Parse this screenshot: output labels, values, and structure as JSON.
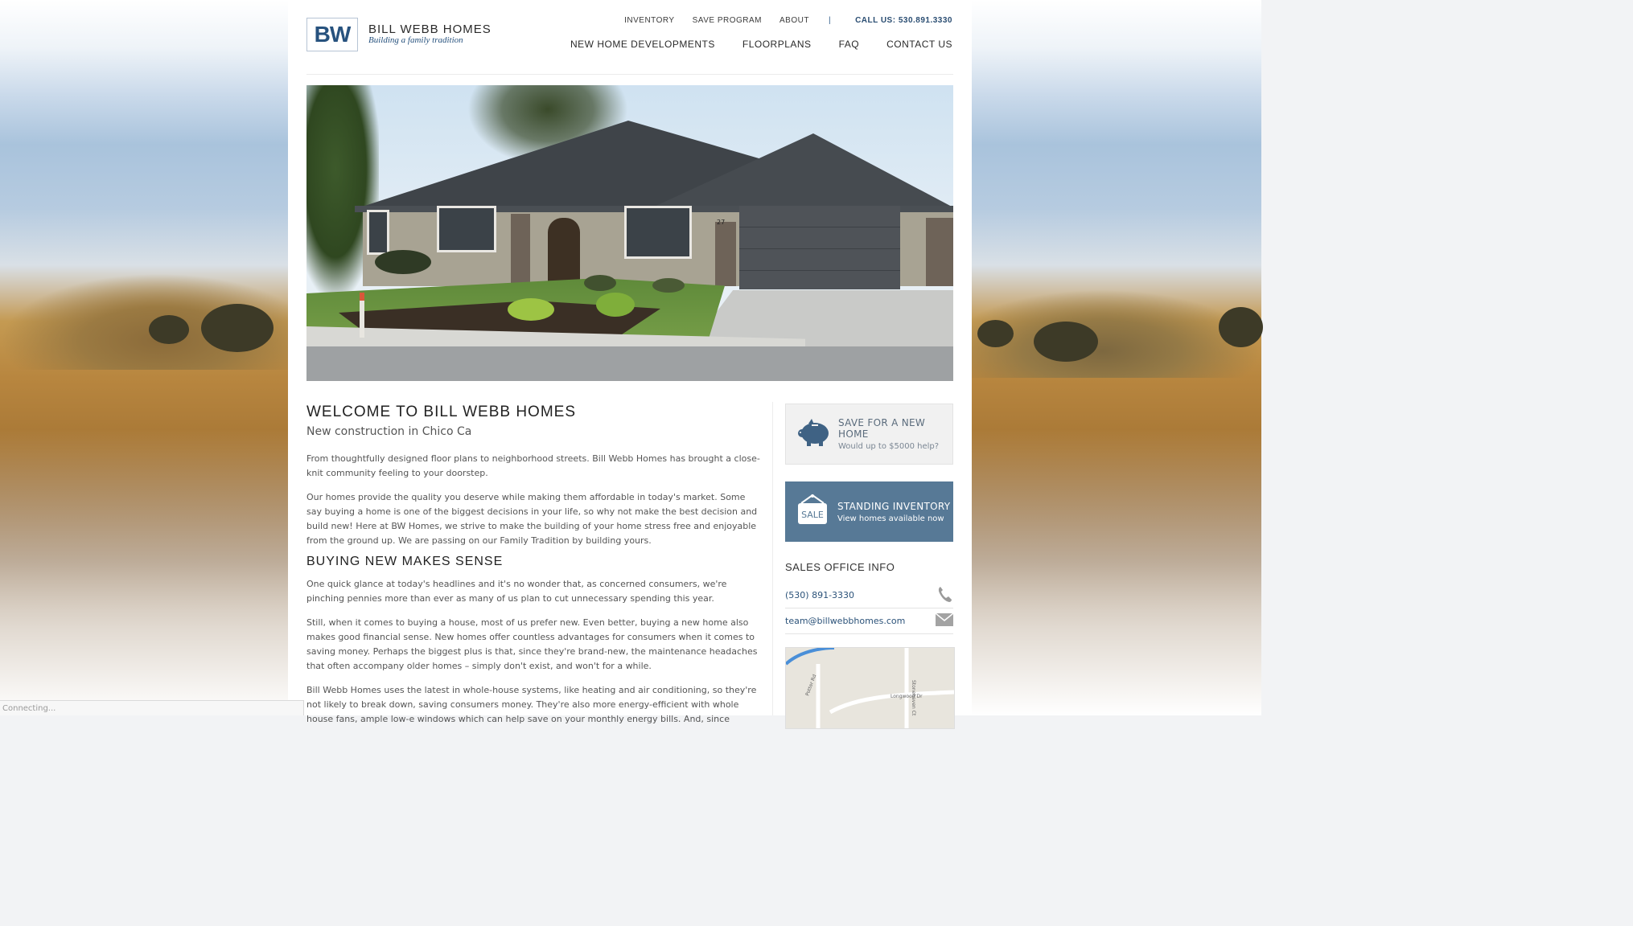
{
  "brand": {
    "monogram": "BW",
    "name": "BILL WEBB HOMES",
    "tagline": "Building a family tradition",
    "accent": "#27527e"
  },
  "top_nav": {
    "items": [
      "INVENTORY",
      "SAVE PROGRAM",
      "ABOUT"
    ],
    "separator": "|",
    "call": "CALL US: 530.891.3330"
  },
  "main_nav": {
    "items": [
      "NEW HOME DEVELOPMENTS",
      "FLOORPLANS",
      "FAQ",
      "CONTACT US"
    ]
  },
  "hero": {
    "house_number": "27"
  },
  "welcome": {
    "title": "WELCOME TO BILL WEBB HOMES",
    "subtitle": "New construction in Chico Ca",
    "paragraphs": [
      "From thoughtfully designed floor plans to neighborhood streets. Bill Webb Homes has brought a close-knit community feeling to your doorstep.",
      "Our homes provide the quality you deserve while making them affordable in today's market. Some say buying a home is one of the biggest decisions in your life, so why not make the best decision and build new! Here at BW Homes, we strive to make the building of your home stress free and enjoyable from the ground up. We are passing on our Family Tradition by building yours."
    ]
  },
  "buying": {
    "title": "BUYING NEW MAKES SENSE",
    "paragraphs": [
      "One quick glance at today's headlines and it's no wonder that, as concerned consumers, we're pinching pennies more than ever as many of us plan to cut unnecessary spending this year.",
      "Still, when it comes to buying a house, most of us prefer new. Even better, buying a new home also makes good financial sense. New homes offer countless advantages for consumers when it comes to saving money. Perhaps the biggest plus is that, since they're brand-new, the maintenance headaches that often accompany older homes – simply don't exist, and won't for a while.",
      "Bill Webb Homes uses the latest in whole-house systems, like heating and air conditioning, so they're not likely to break down, saving consumers money. They're also more energy-efficient with whole house fans, ample low-e windows which can help save on your monthly energy bills. And, since"
    ]
  },
  "sidebar": {
    "save_card": {
      "title": "SAVE FOR A NEW HOME",
      "subtitle": "Would up to $5000 help?",
      "icon": "piggy-bank-icon"
    },
    "inventory_card": {
      "title": "STANDING INVENTORY",
      "subtitle": "View homes available now",
      "icon_label": "SALE",
      "icon": "sale-sign-icon",
      "color": "#577996"
    },
    "office_title": "SALES OFFICE INFO",
    "phone": "(530) 891-3330",
    "email": "team@billwebbhomes.com",
    "map_labels": [
      "Potter Rd",
      "Stonehaven Ct",
      "Longwood Dr"
    ]
  },
  "status_bar": "Connecting..."
}
